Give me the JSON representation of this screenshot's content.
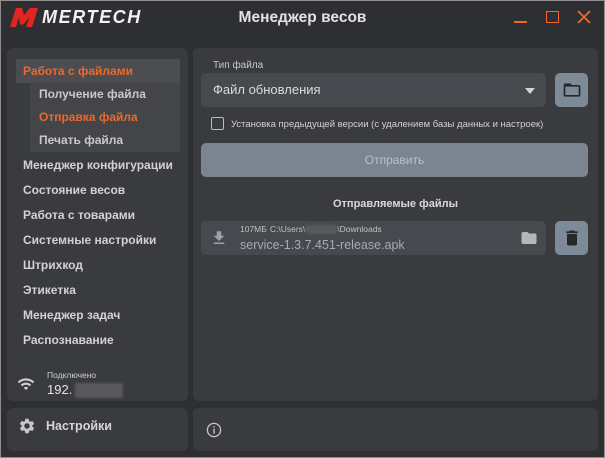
{
  "window": {
    "logo_icon": "mertech-logo-icon",
    "brand": "MERTECH",
    "title": "Менеджер весов",
    "controls": [
      "minimize-icon",
      "maximize-icon",
      "close-icon"
    ]
  },
  "sidebar": {
    "items": [
      {
        "label": "Работа с файлами",
        "active": true,
        "children": [
          {
            "label": "Получение файла",
            "active": false
          },
          {
            "label": "Отправка файла",
            "active": true
          },
          {
            "label": "Печать файла",
            "active": false
          }
        ]
      },
      {
        "label": "Менеджер конфигурации",
        "active": false
      },
      {
        "label": "Состояние весов",
        "active": false
      },
      {
        "label": "Работа с товарами",
        "active": false
      },
      {
        "label": "Системные настройки",
        "active": false
      },
      {
        "label": "Штрихкод",
        "active": false
      },
      {
        "label": "Этикетка",
        "active": false
      },
      {
        "label": "Менеджер задач",
        "active": false
      },
      {
        "label": "Распознавание",
        "active": false
      }
    ],
    "connection": {
      "icon": "wifi-icon",
      "status": "Подключено",
      "ip": "192."
    }
  },
  "settings": {
    "icon": "gear-icon",
    "label": "Настройки"
  },
  "main": {
    "file_type": {
      "label": "Тип файла",
      "value": "Файл обновления",
      "icon": "chevron-down-icon"
    },
    "browse_button": {
      "icon": "folder-open-icon"
    },
    "previous_version": {
      "label": "Установка предыдущей версии (с удалением базы данных и настроек)",
      "checked": false
    },
    "send_button": {
      "label": "Отправить"
    },
    "files_heading": "Отправляемые файлы",
    "files": [
      {
        "icon": "download-icon",
        "size": "107МБ",
        "path_start": "C:\\Users\\",
        "path_end": "\\Downloads",
        "name": "service-1.3.7.451-release.apk",
        "folder_icon": "folder-icon"
      }
    ],
    "delete_button": {
      "icon": "trash-icon"
    }
  },
  "status_bar": {
    "icon": "info-icon"
  },
  "colors": {
    "accent": "#ec682c",
    "logo_red": "#e2261f",
    "window_bg": "#2d2f32",
    "panel_bg": "#393b3e",
    "field_bg": "#46494d",
    "action_button_bg": "#7e8a97",
    "send_button_bg": "#7a8591"
  }
}
